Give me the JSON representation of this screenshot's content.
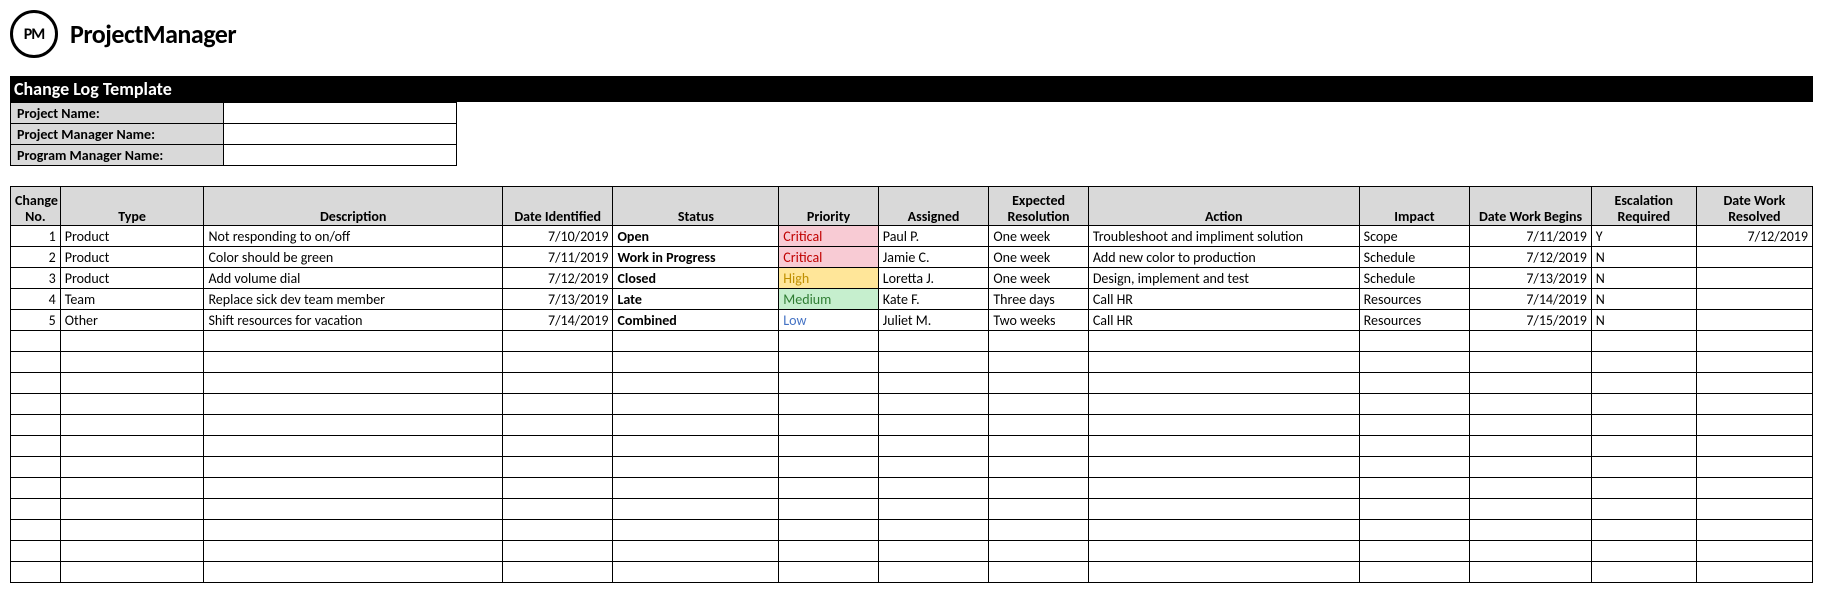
{
  "brand": {
    "logo_initials": "PM",
    "name": "ProjectManager"
  },
  "title": "Change Log Template",
  "meta": {
    "labels": [
      "Project Name:",
      "Project Manager Name:",
      "Program Manager Name:"
    ],
    "values": [
      "",
      "",
      ""
    ]
  },
  "columns": [
    "Change No.",
    "Type",
    "Description",
    "Date Identified",
    "Status",
    "Priority",
    "Assigned",
    "Expected Resolution",
    "Action",
    "Impact",
    "Date Work Begins",
    "Escalation Required",
    "Date Work Resolved"
  ],
  "rows": [
    {
      "no": "1",
      "type": "Product",
      "description": "Not responding to on/off",
      "date_identified": "7/10/2019",
      "status": "Open",
      "priority": "Critical",
      "assigned": "Paul P.",
      "expected_resolution": "One week",
      "action": "Troubleshoot and impliment solution",
      "impact": "Scope",
      "date_work_begins": "7/11/2019",
      "escalation": "Y",
      "date_work_resolved": "7/12/2019"
    },
    {
      "no": "2",
      "type": "Product",
      "description": "Color should be green",
      "date_identified": "7/11/2019",
      "status": "Work in Progress",
      "priority": "Critical",
      "assigned": "Jamie C.",
      "expected_resolution": "One week",
      "action": "Add new color to production",
      "impact": "Schedule",
      "date_work_begins": "7/12/2019",
      "escalation": "N",
      "date_work_resolved": ""
    },
    {
      "no": "3",
      "type": "Product",
      "description": "Add volume dial",
      "date_identified": "7/12/2019",
      "status": "Closed",
      "priority": "High",
      "assigned": "Loretta J.",
      "expected_resolution": "One week",
      "action": "Design, implement and test",
      "impact": "Schedule",
      "date_work_begins": "7/13/2019",
      "escalation": "N",
      "date_work_resolved": ""
    },
    {
      "no": "4",
      "type": "Team",
      "description": "Replace sick dev team member",
      "date_identified": "7/13/2019",
      "status": "Late",
      "priority": "Medium",
      "assigned": "Kate F.",
      "expected_resolution": "Three days",
      "action": "Call HR",
      "impact": "Resources",
      "date_work_begins": "7/14/2019",
      "escalation": "N",
      "date_work_resolved": ""
    },
    {
      "no": "5",
      "type": "Other",
      "description": "Shift resources for vacation",
      "date_identified": "7/14/2019",
      "status": "Combined",
      "priority": "Low",
      "assigned": "Juliet M.",
      "expected_resolution": "Two weeks",
      "action": "Call HR",
      "impact": "Resources",
      "date_work_begins": "7/15/2019",
      "escalation": "N",
      "date_work_resolved": ""
    }
  ],
  "empty_rows": 12,
  "priority_styles": {
    "Critical": "prio-critical",
    "High": "prio-high",
    "Medium": "prio-medium",
    "Low": "prio-low"
  }
}
